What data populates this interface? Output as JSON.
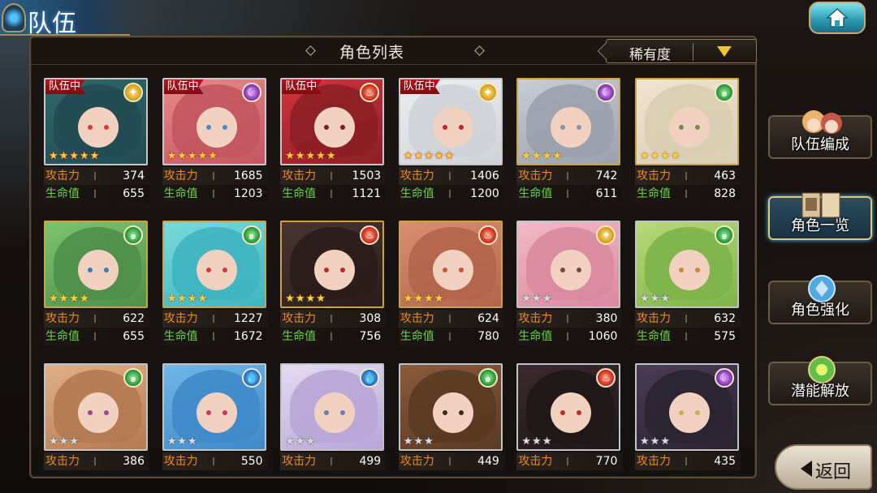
{
  "header": {
    "title": "队伍",
    "home_icon": "home-icon"
  },
  "panel": {
    "title": "角色列表",
    "sort_label": "稀有度"
  },
  "labels": {
    "atk": "攻击力",
    "hp": "生命值"
  },
  "colors": {
    "accent_gold": "#c9a24a",
    "in_team_red": "#b3141c",
    "atk_orange": "#f08a22",
    "hp_green": "#6ed34a"
  },
  "characters": [
    {
      "in_team": "队伍中",
      "element": "light",
      "stars": 5,
      "star_style": "red",
      "atk": "374",
      "hp": "655"
    },
    {
      "in_team": "队伍中",
      "element": "dark",
      "stars": 5,
      "star_style": "red",
      "atk": "1685",
      "hp": "1203"
    },
    {
      "in_team": "队伍中",
      "element": "fire",
      "stars": 5,
      "star_style": "red",
      "atk": "1503",
      "hp": "1121"
    },
    {
      "in_team": "队伍中",
      "element": "light",
      "stars": 5,
      "star_style": "red",
      "atk": "1406",
      "hp": "1200"
    },
    {
      "in_team": "",
      "element": "dark",
      "stars": 4,
      "star_style": "gold",
      "atk": "742",
      "hp": "611"
    },
    {
      "in_team": "",
      "element": "wind",
      "stars": 4,
      "star_style": "gold",
      "atk": "463",
      "hp": "828"
    },
    {
      "in_team": "",
      "element": "wind",
      "stars": 4,
      "star_style": "gold",
      "atk": "622",
      "hp": "655"
    },
    {
      "in_team": "",
      "element": "wind",
      "stars": 4,
      "star_style": "gold",
      "atk": "1227",
      "hp": "1672"
    },
    {
      "in_team": "",
      "element": "fire",
      "stars": 4,
      "star_style": "gold",
      "atk": "308",
      "hp": "756"
    },
    {
      "in_team": "",
      "element": "fire",
      "stars": 4,
      "star_style": "gold",
      "atk": "624",
      "hp": "780"
    },
    {
      "in_team": "",
      "element": "light",
      "stars": 3,
      "star_style": "silver",
      "atk": "380",
      "hp": "1060"
    },
    {
      "in_team": "",
      "element": "wind",
      "stars": 3,
      "star_style": "silver",
      "atk": "632",
      "hp": "575"
    },
    {
      "in_team": "",
      "element": "wind",
      "stars": 3,
      "star_style": "silver",
      "atk": "386",
      "hp": ""
    },
    {
      "in_team": "",
      "element": "water",
      "stars": 3,
      "star_style": "silver",
      "atk": "550",
      "hp": ""
    },
    {
      "in_team": "",
      "element": "water",
      "stars": 3,
      "star_style": "silver",
      "atk": "499",
      "hp": ""
    },
    {
      "in_team": "",
      "element": "wind",
      "stars": 3,
      "star_style": "silver",
      "atk": "449",
      "hp": ""
    },
    {
      "in_team": "",
      "element": "fire",
      "stars": 3,
      "star_style": "silver",
      "atk": "770",
      "hp": ""
    },
    {
      "in_team": "",
      "element": "dark",
      "stars": 3,
      "star_style": "silver",
      "atk": "435",
      "hp": ""
    }
  ],
  "side_menu": [
    {
      "label": "队伍编成",
      "icon": "team-portraits-icon",
      "active": false
    },
    {
      "label": "角色一览",
      "icon": "book-icon",
      "active": true
    },
    {
      "label": "角色强化",
      "icon": "enhance-orb-icon",
      "active": false
    },
    {
      "label": "潜能解放",
      "icon": "potential-orb-icon",
      "active": false
    }
  ],
  "back": {
    "label": "返回",
    "icon": "back-arrow-icon"
  }
}
